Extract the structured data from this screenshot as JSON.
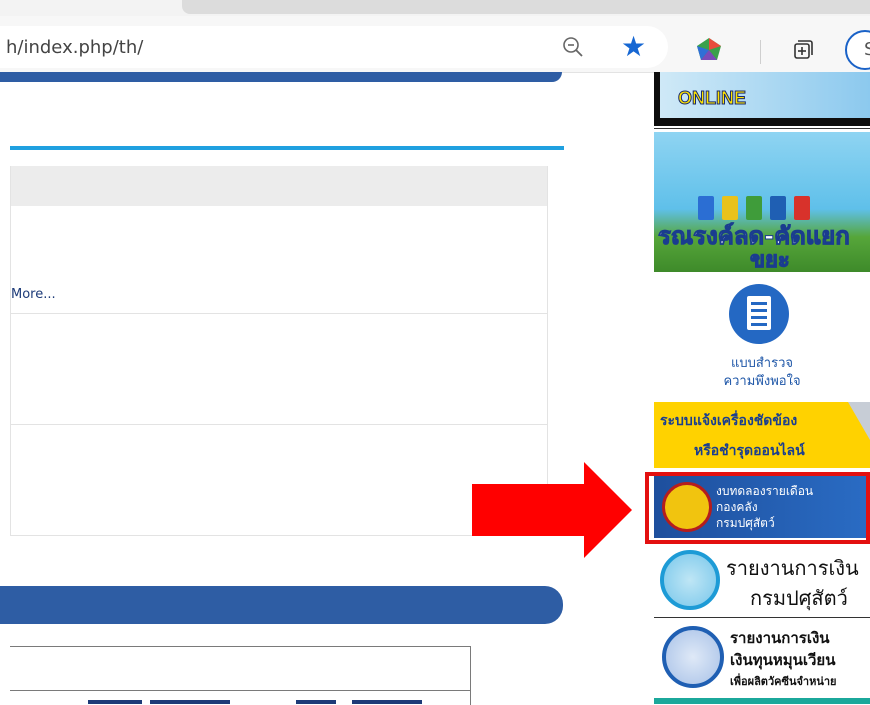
{
  "browser": {
    "url": "h/index.php/th/",
    "icons": [
      "zoom-out-icon",
      "favorite-star-icon",
      "extension-icon",
      "collections-icon",
      "profile-icon"
    ],
    "profile_initial": "S"
  },
  "content": {
    "more_link": "More..."
  },
  "sidebar": {
    "online_label": "ONLINE",
    "waste_line1": "รณรงค์ลด-คัดแยก",
    "waste_line2": "ขยะ",
    "survey_line1": "แบบสำรวจ",
    "survey_line2": "ความพึงพอใจ",
    "repair_line1": "ระบบแจ้งเครื่องชัดข้อง",
    "repair_line2": "หรือชำรุดออนไลน์",
    "budget_line1": "งบทดลองรายเดือน",
    "budget_line2": "กองคลัง",
    "budget_line3": "กรมปศุสัตว์",
    "finance_line1": "รายงานการเงิน",
    "finance_line2": "กรมปศุสัตว์",
    "fund_line1": "รายงานการเงิน",
    "fund_line2": "เงินทุนหมุนเวียน",
    "fund_line3": "เพื่อผลิตวัคซีนจำหน่าย"
  },
  "colors": {
    "highlight": "#e31010",
    "header_blue": "#2e5da4",
    "accent_rule": "#1fa0e0",
    "star": "#1667d3"
  }
}
